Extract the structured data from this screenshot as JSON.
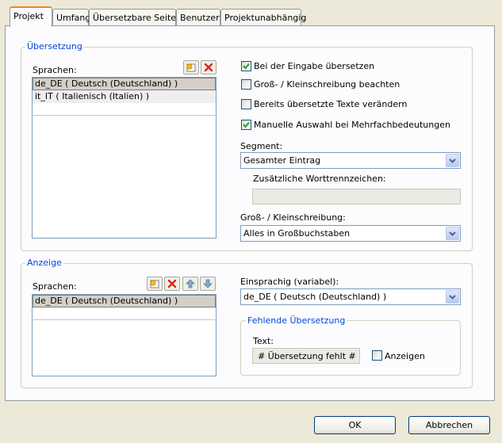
{
  "tabs": [
    {
      "label": "Projekt",
      "active": true
    },
    {
      "label": "Umfang"
    },
    {
      "label": "Übersetzbare Seiten"
    },
    {
      "label": "Benutzer"
    },
    {
      "label": "Projektunabhängig"
    }
  ],
  "translation": {
    "title": "Übersetzung",
    "languages_label": "Sprachen:",
    "languages": [
      "de_DE ( Deutsch (Deutschland) )",
      "it_IT ( Italienisch (Italien) )"
    ],
    "checkboxes": [
      {
        "label": "Bei der Eingabe übersetzen",
        "checked": true
      },
      {
        "label": "Groß- / Kleinschreibung beachten",
        "checked": false
      },
      {
        "label": "Bereits übersetzte Texte verändern",
        "checked": false
      },
      {
        "label": "Manuelle Auswahl bei Mehrfachbedeutungen",
        "checked": true
      }
    ],
    "segment_label": "Segment:",
    "segment_value": "Gesamter Eintrag",
    "separators_label": "Zusätzliche Worttrennzeichen:",
    "separators_value": "",
    "case_label": "Groß- / Kleinschreibung:",
    "case_value": "Alles in Großbuchstaben"
  },
  "display": {
    "title": "Anzeige",
    "languages_label": "Sprachen:",
    "languages": [
      "de_DE ( Deutsch (Deutschland) )"
    ],
    "mono_label": "Einsprachig (variabel):",
    "mono_value": "de_DE ( Deutsch (Deutschland) )",
    "missing": {
      "title": "Fehlende Übersetzung",
      "text_label": "Text:",
      "text_value": "# Übersetzung fehlt #",
      "show_label": "Anzeigen",
      "show_checked": false
    }
  },
  "buttons": {
    "ok": "OK",
    "cancel": "Abbrechen"
  },
  "icons": [
    "new-item-icon",
    "delete-icon",
    "move-up-icon",
    "move-down-icon",
    "checkmark-icon",
    "dropdown-arrow-icon"
  ],
  "colors": {
    "accent_tab": "#e68b2c",
    "group_title": "#0046d5",
    "delete_red": "#d8261c"
  }
}
